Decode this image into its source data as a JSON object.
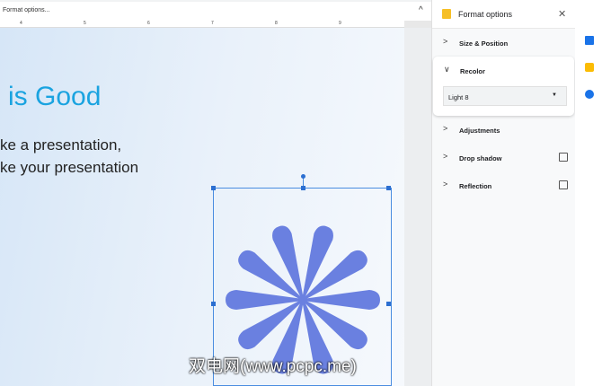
{
  "topbar": {
    "title": "Format options..."
  },
  "ruler": {
    "numbers": [
      "4",
      "5",
      "6",
      "7",
      "8",
      "9"
    ]
  },
  "slide": {
    "heading": "is Good",
    "line1": "ke a presentation,",
    "line2": "ke your presentation"
  },
  "panel": {
    "title": "Format options",
    "sections": {
      "size": "Size & Position",
      "recolor": "Recolor",
      "adjust": "Adjustments",
      "shadow": "Drop shadow",
      "reflection": "Reflection"
    },
    "recolor_value": "Light 8",
    "drop_shadow_checked": false,
    "reflection_checked": false
  },
  "watermark": "双电网(www.pcpc.me)",
  "colors": {
    "accent": "#1aa3e0",
    "shape": "#6a80e0",
    "selection": "#4a8de0"
  }
}
